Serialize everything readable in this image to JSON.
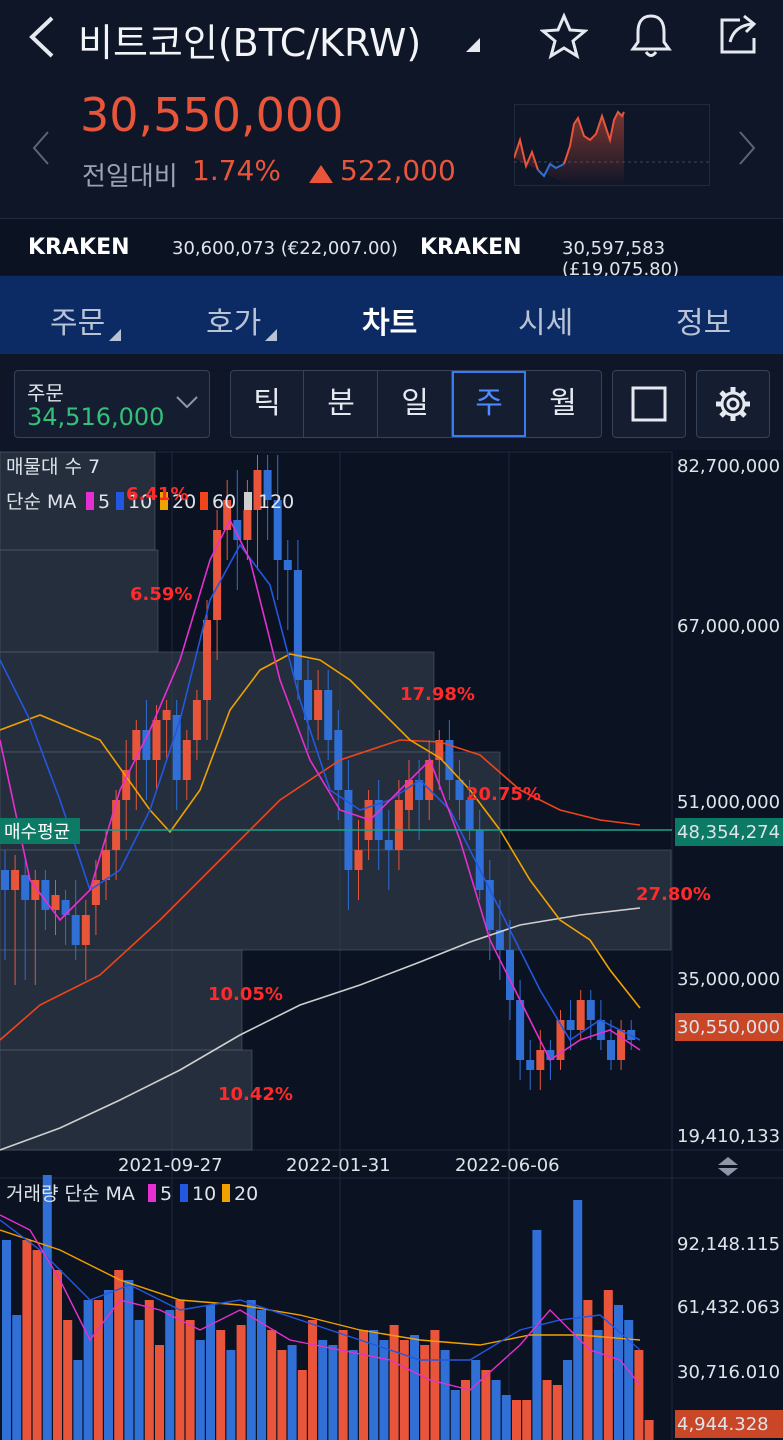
{
  "header": {
    "title": "비트코인(BTC/KRW)",
    "price": "30,550,000",
    "change_label": "전일대비",
    "change_pct": "1.74%",
    "change_amount": "522,000"
  },
  "exchanges": [
    {
      "name": "KRAKEN",
      "value": "30,600,073 (€22,007.00)"
    },
    {
      "name": "KRAKEN",
      "value": "30,597,583 (£19,075.80)"
    }
  ],
  "tabs": [
    {
      "label": "주문"
    },
    {
      "label": "호가"
    },
    {
      "label": "차트"
    },
    {
      "label": "시세"
    },
    {
      "label": "정보"
    }
  ],
  "order": {
    "label": "주문",
    "value": "34,516,000"
  },
  "periods": [
    {
      "label": "틱"
    },
    {
      "label": "분"
    },
    {
      "label": "일"
    },
    {
      "label": "주"
    },
    {
      "label": "월"
    }
  ],
  "colors": {
    "up": "#e8553a",
    "down": "#2f6fd6",
    "accent": "#3a7bef",
    "avg": "#19a28a"
  },
  "icons": {
    "back": "chevron-left-icon",
    "star": "star-icon",
    "bell": "bell-icon",
    "share": "share-icon",
    "settings": "gear-icon"
  },
  "chart_data": {
    "type": "candlestick",
    "overlay_label": "매물대 수 7",
    "ma_label": "단순 MA",
    "ma_periods": [
      "5",
      "10",
      "20",
      "60",
      "120"
    ],
    "ma_colors": [
      "#e62fd0",
      "#2457e0",
      "#f2a100",
      "#f0451a",
      "#cfcfcf"
    ],
    "y_ticks": [
      "82,700,000",
      "67,000,000",
      "51,000,000",
      "35,000,000",
      "19,410,133"
    ],
    "avg_price_label": "매수평균",
    "avg_price_value": "48,354,274",
    "current_price_value": "30,550,000",
    "x_ticks": [
      "2021-09-27",
      "2022-01-31",
      "2022-06-06"
    ],
    "volume_profile_labels": [
      "6.41%",
      "6.59%",
      "17.98%",
      "20.75%",
      "27.80%",
      "10.05%",
      "10.42%"
    ],
    "volume": {
      "label": "거래량 단순 MA",
      "ma_periods": [
        "5",
        "10",
        "20"
      ],
      "y_ticks": [
        "92,148.115",
        "61,432.063",
        "30,716.010"
      ],
      "current_value": "4,944.328"
    }
  }
}
